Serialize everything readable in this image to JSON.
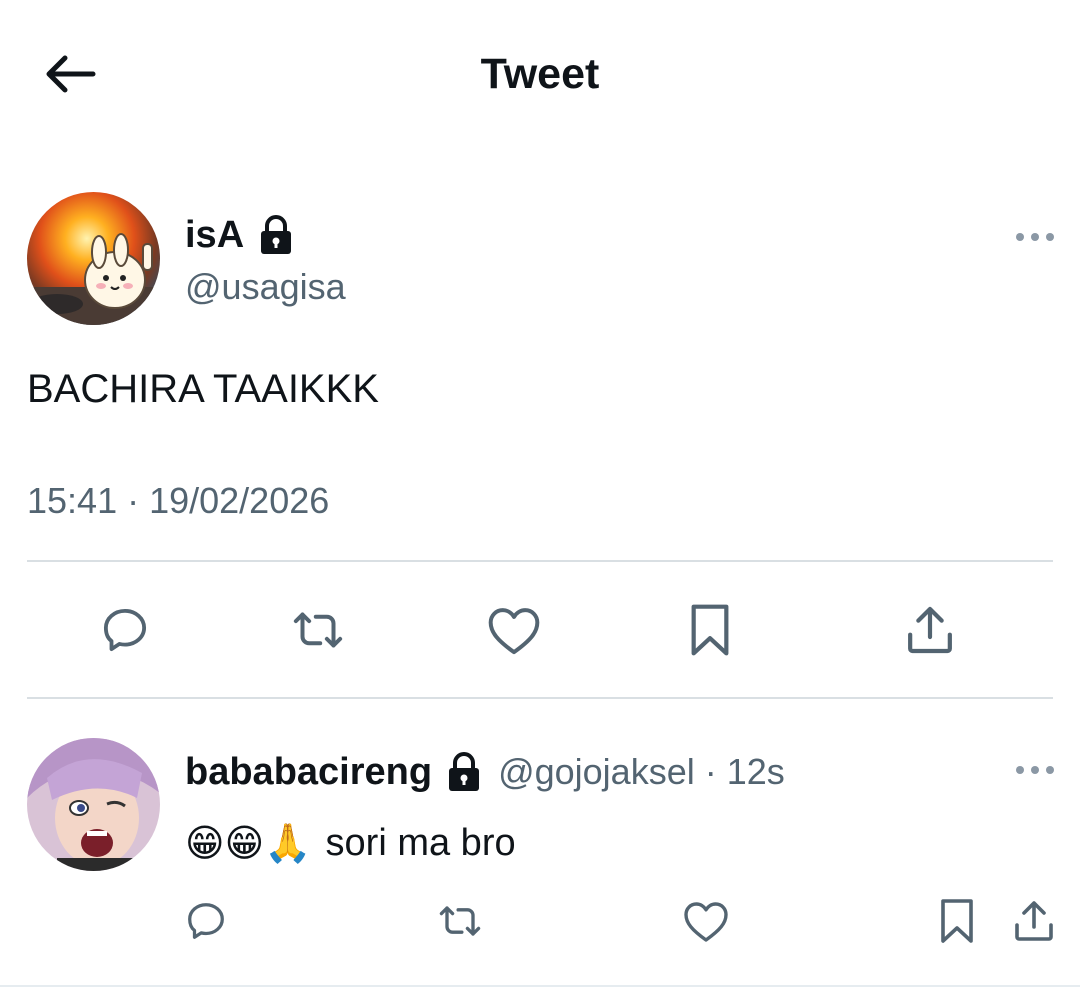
{
  "header": {
    "title": "Tweet",
    "back_icon": "arrow-left-icon"
  },
  "main_tweet": {
    "display_name": "isA",
    "handle": "@usagisa",
    "protected": true,
    "text": "BACHIRA TAAIKKK",
    "timestamp": "15:41 · 19/02/2026",
    "actions": [
      "reply-icon",
      "retweet-icon",
      "like-icon",
      "bookmark-icon",
      "share-icon"
    ]
  },
  "reply": {
    "display_name": "bababacireng",
    "handle": "@gojojaksel",
    "time_ago": "· 12s",
    "protected": true,
    "emojis": "😁😁🙏",
    "text": "sori ma bro",
    "actions": [
      "reply-icon",
      "retweet-icon",
      "like-icon",
      "bookmark-icon",
      "share-icon"
    ]
  },
  "colors": {
    "text_primary": "#0f1419",
    "text_secondary": "#536471",
    "divider": "#d9dfe3"
  }
}
